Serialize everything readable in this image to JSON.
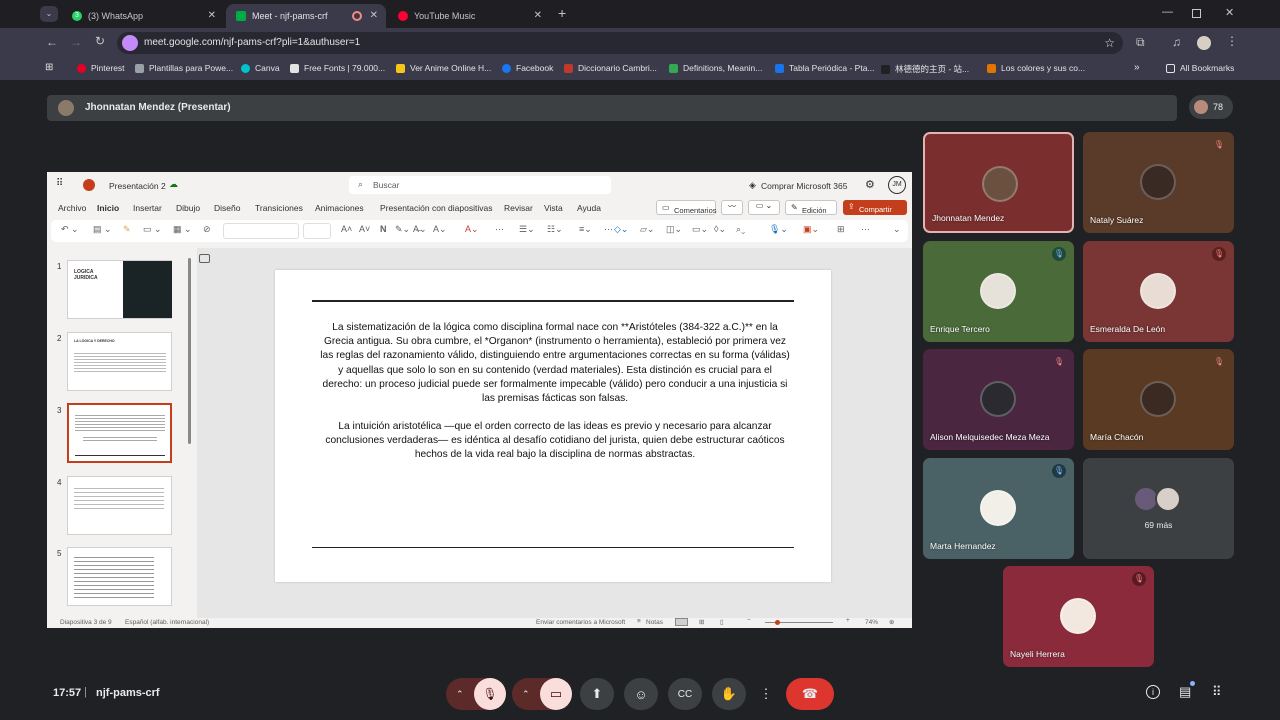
{
  "browser": {
    "tabs": [
      {
        "label": "(3) WhatsApp",
        "icon": "whatsapp-icon",
        "color": "#25d366",
        "badge": "3"
      },
      {
        "label": "Meet - njf-pams-crf",
        "icon": "meet-icon",
        "color": "#00ac47"
      },
      {
        "label": "YouTube Music",
        "icon": "youtube-music-icon",
        "color": "#ff0033"
      }
    ],
    "url": "meet.google.com/njf-pams-crf?pli=1&authuser=1",
    "bookmarks": [
      {
        "label": "Pinterest",
        "color": "#e60023"
      },
      {
        "label": "Plantillas para Powe...",
        "color": "#9aa0a6"
      },
      {
        "label": "Canva",
        "color": "#00c4cc"
      },
      {
        "label": "Free Fonts | 79.000...",
        "color": "#e3e3e3"
      },
      {
        "label": "Ver Anime Online H...",
        "color": "#f5c518"
      },
      {
        "label": "Facebook",
        "color": "#1877f2"
      },
      {
        "label": "Diccionario Cambri...",
        "color": "#c0392b"
      },
      {
        "label": "Definitions, Meanin...",
        "color": "#34a853"
      },
      {
        "label": "Tabla Periódica - Pta...",
        "color": "#1a73e8"
      },
      {
        "label": "林德德的主页 - 站...",
        "color": "#202124"
      },
      {
        "label": "Los colores y sus co...",
        "color": "#e37400"
      }
    ],
    "all_bookmarks": "All Bookmarks"
  },
  "meet": {
    "presenter_label": "Jhonnatan Mendez (Presentar)",
    "participant_count": "78",
    "time": "17:57",
    "meeting_code": "njf-pams-crf",
    "more_label": "69 más",
    "participants": [
      {
        "name": "Jhonnatan Mendez",
        "bg": "#7a2e2e",
        "active": true,
        "muted": false
      },
      {
        "name": "Nataly Suárez",
        "bg": "#5a3a28",
        "active": false,
        "muted": true
      },
      {
        "name": "Enrique Tercero",
        "bg": "#4a6a3a",
        "active": false,
        "muted": false
      },
      {
        "name": "Esmeralda De León",
        "bg": "#7a3535",
        "active": false,
        "muted": true
      },
      {
        "name": "Alison Melquisedec Meza Meza",
        "bg": "#4a2640",
        "active": false,
        "muted": true
      },
      {
        "name": "María Chacón",
        "bg": "#5a3a22",
        "active": false,
        "muted": true
      },
      {
        "name": "Marta Hernandez",
        "bg": "#4a6266",
        "active": false,
        "muted": false
      },
      {
        "name": "Nayeli Herrera",
        "bg": "#8a2a3a",
        "active": false,
        "muted": true
      }
    ]
  },
  "ppt": {
    "doc_title": "Presentación 2",
    "search_placeholder": "Buscar",
    "buy_label": "Comprar Microsoft 365",
    "user_initials": "JM",
    "menu": [
      "Archivo",
      "Inicio",
      "Insertar",
      "Dibujo",
      "Diseño",
      "Transiciones",
      "Animaciones",
      "Presentación con diapositivas",
      "Revisar",
      "Vista",
      "Ayuda"
    ],
    "comments_label": "Comentarios",
    "edit_label": "Edición",
    "share_label": "Compartir",
    "thumb_numbers": [
      "1",
      "2",
      "3",
      "4",
      "5"
    ],
    "thumb1_title": "LOGICA JURIDICA",
    "thumb2_title": "LA LÓGICA Y DERECHO",
    "slide_p1": "La sistematización de la lógica como disciplina formal nace con **Aristóteles (384-322 a.C.)** en la Grecia antigua. Su obra cumbre, el *Organon* (instrumento o herramienta), estableció por primera vez las reglas del razonamiento válido, distinguiendo entre argumentaciones correctas en su forma (válidas) y aquellas que solo lo son en su contenido (verdad materiales). Esta distinción es crucial para el derecho: un proceso judicial puede ser formalmente impecable (válido) pero conducir a una injusticia si las premisas fácticas son falsas.",
    "slide_p2": "La intuición aristotélica —que el orden correcto de las ideas es previo y necesario para alcanzar conclusiones verdaderas— es idéntica al desafío cotidiano del jurista, quien debe estructurar caóticos hechos de la vida real bajo la disciplina de normas abstractas.",
    "status_slide": "Diapositiva 3 de 9",
    "status_lang": "Español (alfab. internacional)",
    "status_feedback": "Enviar comentarios a Microsoft",
    "status_notes": "Notas",
    "zoom": "74%"
  }
}
